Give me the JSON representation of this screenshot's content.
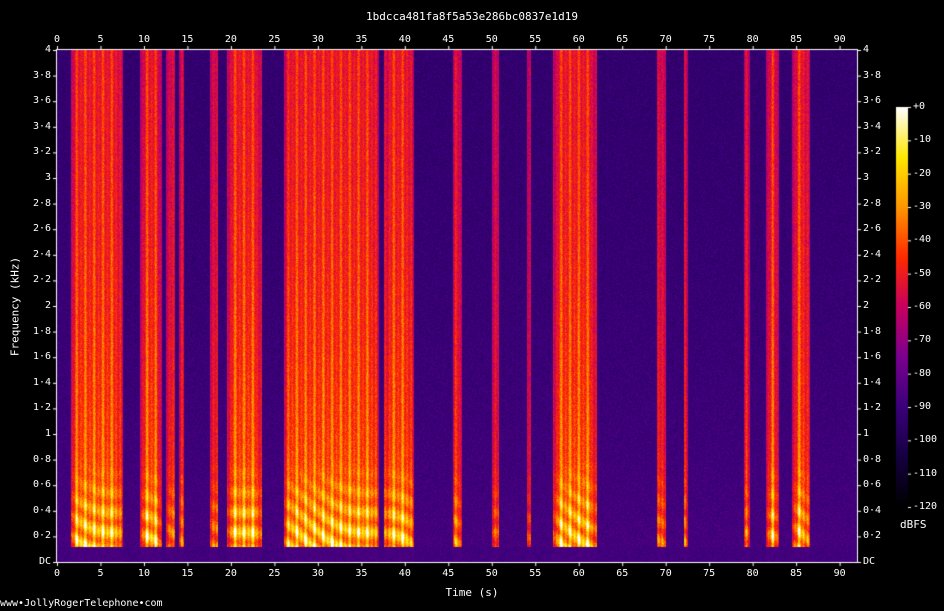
{
  "chart_data": {
    "type": "heatmap",
    "title": "1bdcca481fa8f5a53e286bc0837e1d19",
    "xlabel": "Time (s)",
    "ylabel": "Frequency (kHz)",
    "xlim": [
      0,
      92
    ],
    "ylim": [
      0,
      4
    ],
    "x_ticks": [
      "0",
      "5",
      "10",
      "15",
      "20",
      "25",
      "30",
      "35",
      "40",
      "45",
      "50",
      "55",
      "60",
      "65",
      "70",
      "75",
      "80",
      "85",
      "90"
    ],
    "y_ticks": [
      "DC",
      "0·2",
      "0·4",
      "0·6",
      "0·8",
      "1",
      "1·2",
      "1·4",
      "1·6",
      "1·8",
      "2",
      "2·2",
      "2·4",
      "2·6",
      "2·8",
      "3",
      "3·2",
      "3·4",
      "3·6",
      "3·8",
      "4"
    ],
    "colorbar": {
      "unit": "dBFS",
      "ticks": [
        "+0",
        "-10",
        "-20",
        "-30",
        "-40",
        "-50",
        "-60",
        "-70",
        "-80",
        "-90",
        "-100",
        "-110",
        "-120"
      ],
      "range": [
        -120,
        0
      ],
      "colors": [
        "#000000",
        "#150040",
        "#3a007a",
        "#7a0090",
        "#c80060",
        "#ff2a00",
        "#ff9600",
        "#ffe800",
        "#ffffff"
      ]
    },
    "speech_segments_s": [
      [
        1.5,
        7.5
      ],
      [
        9.5,
        12.0
      ],
      [
        12.5,
        13.5
      ],
      [
        14.0,
        14.5
      ],
      [
        17.5,
        18.5
      ],
      [
        19.5,
        23.5
      ],
      [
        26.0,
        37.0
      ],
      [
        37.5,
        41.0
      ],
      [
        45.5,
        46.5
      ],
      [
        50.0,
        50.8
      ],
      [
        54.0,
        54.5
      ],
      [
        57.0,
        62.0
      ],
      [
        69.0,
        70.0
      ],
      [
        72.0,
        72.5
      ],
      [
        79.0,
        79.6
      ],
      [
        81.5,
        83.0
      ],
      [
        84.5,
        86.5
      ]
    ]
  },
  "watermark": "www•JollyRogerTelephone•com"
}
